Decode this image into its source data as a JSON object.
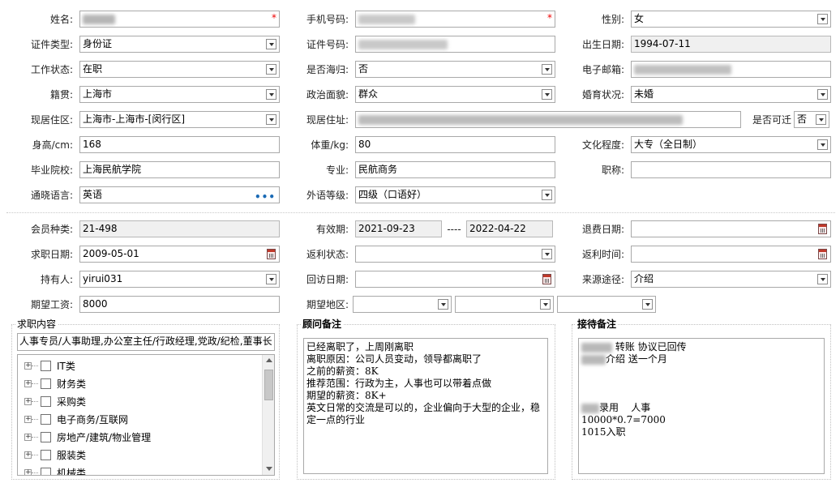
{
  "labels": {
    "name": "姓名:",
    "phone": "手机号码:",
    "gender": "性别:",
    "id_type": "证件类型:",
    "id_number": "证件号码:",
    "birth_date": "出生日期:",
    "work_status": "工作状态:",
    "returnee": "是否海归:",
    "email": "电子邮箱:",
    "native_place": "籍贯:",
    "political_status": "政治面貌:",
    "marital_status": "婚育状况:",
    "residence_area": "现居住区:",
    "address": "现居住址:",
    "relocatable": "是否可迁",
    "height": "身高/cm:",
    "weight": "体重/kg:",
    "education": "文化程度:",
    "school": "毕业院校:",
    "major": "专业:",
    "title": "职称:",
    "language": "通晓语言:",
    "language_level": "外语等级:",
    "member_type": "会员种类:",
    "valid_period": "有效期:",
    "refund_date": "退费日期:",
    "job_date": "求职日期:",
    "rebate_status": "返利状态:",
    "rebate_time": "返利时间:",
    "holder": "持有人:",
    "return_visit_date": "回访日期:",
    "source_channel": "来源途径:",
    "expected_salary": "期望工资:",
    "expected_region": "期望地区:"
  },
  "values": {
    "gender": "女",
    "id_type": "身份证",
    "birth_date": "1994-07-11",
    "work_status": "在职",
    "returnee": "否",
    "native_place": "上海市",
    "political_status": "群众",
    "marital_status": "未婚",
    "residence_area": "上海市-上海市-[闵行区]",
    "relocatable": "否",
    "height": "168",
    "weight": "80",
    "education": "大专（全日制）",
    "school": "上海民航学院",
    "major": "民航商务",
    "title": "",
    "language": "英语",
    "language_level": "四级（口语好）",
    "member_type": "21-498",
    "valid_from": "2021-09-23",
    "valid_sep": "----",
    "valid_to": "2022-04-22",
    "refund_date": "",
    "job_date": "2009-05-01",
    "rebate_status": "",
    "rebate_time": "",
    "holder": "yirui031",
    "return_visit_date": "",
    "source_channel": "介绍",
    "expected_salary": "8000",
    "expected_region_1": "",
    "expected_region_2": "",
    "expected_region_3": ""
  },
  "required_mark": "*",
  "job_content": {
    "legend": "求职内容",
    "selected": "人事专员/人事助理,办公室主任/行政经理,党政/纪检,董事长",
    "categories": [
      "IT类",
      "财务类",
      "采购类",
      "电子商务/互联网",
      "房地产/建筑/物业管理",
      "服装类",
      "机械类"
    ]
  },
  "consultant_notes": {
    "legend": "顾问备注",
    "text": "已经离职了，上周刚离职\n离职原因：公司人员变动，领导都离职了\n之前的薪资：8K\n推荐范围：行政为主，人事也可以带着点做\n期望的薪资：8K+\n英文日常的交流是可以的，企业偏向于大型的企业，稳定一点的行业"
  },
  "reception_notes": {
    "legend": "接待备注",
    "line1": "转账 协议已回传",
    "line2": "介绍 送一个月",
    "line3": "录用    人事",
    "line4": "10000*0.7=7000",
    "line5": "1015入职"
  },
  "icons": {
    "dropdown": "dropdown-arrow-icon",
    "calendar": "calendar-icon",
    "ellipsis": "ellipsis-icon",
    "expand": "expand-plus-icon",
    "checkbox": "checkbox-icon"
  },
  "colors": {
    "required": "#e00000",
    "ellipsis": "#1a6ab5",
    "readonly_bg": "#f0f0f0"
  }
}
